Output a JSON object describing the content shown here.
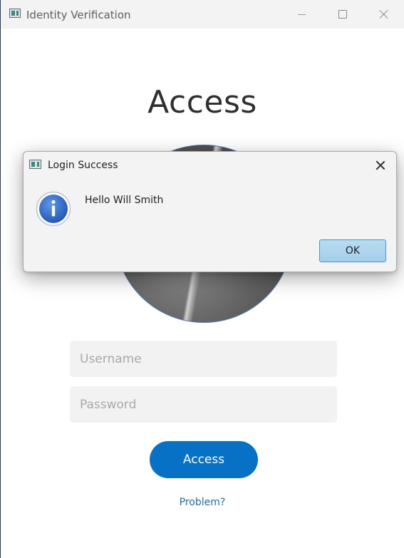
{
  "window": {
    "title": "Identity Verification"
  },
  "main": {
    "heading": "Access",
    "username_placeholder": "Username",
    "password_placeholder": "Password",
    "access_button": "Access",
    "problem_link": "Problem?"
  },
  "dialog": {
    "title": "Login Success",
    "message": "Hello Will Smith",
    "ok_label": "OK",
    "icon": "info-icon"
  },
  "colors": {
    "accent": "#0771c6",
    "link": "#1a6fc0",
    "ok_button": "#b9dcf0"
  }
}
